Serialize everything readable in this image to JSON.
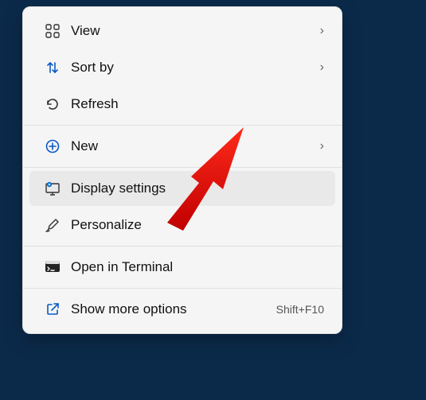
{
  "menu": {
    "items": [
      {
        "id": "view",
        "label": "View",
        "icon": "grid-icon",
        "chevron": true
      },
      {
        "id": "sort",
        "label": "Sort by",
        "icon": "sort-icon",
        "chevron": true
      },
      {
        "id": "refresh",
        "label": "Refresh",
        "icon": "refresh-icon",
        "chevron": false
      },
      {
        "id": "new",
        "label": "New",
        "icon": "plus-circle-icon",
        "chevron": true
      },
      {
        "id": "display",
        "label": "Display settings",
        "icon": "display-gear-icon",
        "chevron": false,
        "hovered": true
      },
      {
        "id": "personalize",
        "label": "Personalize",
        "icon": "brush-icon",
        "chevron": false
      },
      {
        "id": "terminal",
        "label": "Open in Terminal",
        "icon": "terminal-icon",
        "chevron": false
      },
      {
        "id": "more",
        "label": "Show more options",
        "icon": "external-icon",
        "chevron": false,
        "shortcut": "Shift+F10"
      }
    ],
    "chevron_glyph": "›"
  }
}
